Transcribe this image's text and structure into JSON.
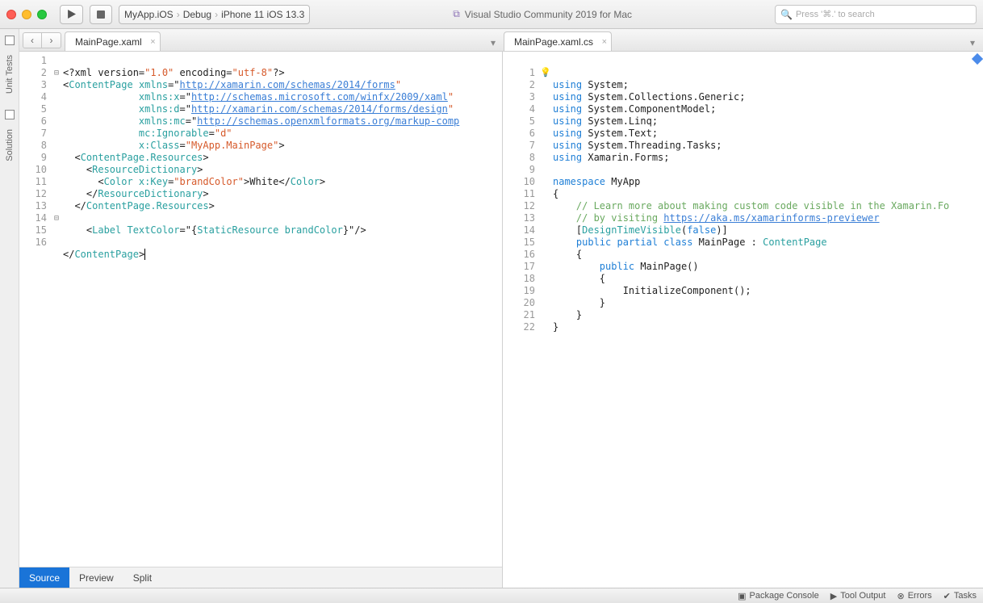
{
  "titlebar": {
    "crumb1": "MyApp.iOS",
    "crumb2": "Debug",
    "crumb3": "iPhone 11 iOS 13.3",
    "app_title": "Visual Studio Community 2019 for Mac",
    "search_placeholder": "Press '⌘.' to search"
  },
  "sidebar": {
    "tab1": "Unit Tests",
    "tab2": "Solution"
  },
  "tabs": {
    "left": "MainPage.xaml",
    "right": "MainPage.xaml.cs"
  },
  "view_tabs": {
    "source": "Source",
    "preview": "Preview",
    "split": "Split"
  },
  "status": {
    "pkg": "Package Console",
    "tool": "Tool Output",
    "errors": "Errors",
    "tasks": "Tasks"
  },
  "left_code": {
    "lines": [
      "1",
      "2",
      "3",
      "4",
      "5",
      "6",
      "7",
      "8",
      "9",
      "10",
      "11",
      "12",
      "13",
      "14",
      "15",
      "16"
    ],
    "l1a": "<?xml version=",
    "l1b": "\"1.0\"",
    "l1c": " encoding=",
    "l1d": "\"utf-8\"",
    "l1e": "?>",
    "l2a": "<",
    "l2b": "ContentPage",
    "l2c": " xmlns",
    "l2d": "=\"",
    "l2e": "http://xamarin.com/schemas/2014/forms",
    "l2f": "\"",
    "l3a": "             xmlns:x",
    "l3b": "=\"",
    "l3c": "http://schemas.microsoft.com/winfx/2009/xaml",
    "l3d": "\"",
    "l4a": "             xmlns:d",
    "l4b": "=\"",
    "l4c": "http://xamarin.com/schemas/2014/forms/design",
    "l4d": "\"",
    "l5a": "             xmlns:mc",
    "l5b": "=\"",
    "l5c": "http://schemas.openxmlformats.org/markup-comp",
    "l6a": "             mc:Ignorable",
    "l6b": "=",
    "l6c": "\"d\"",
    "l7a": "             x:Class",
    "l7b": "=",
    "l7c": "\"MyApp.MainPage\"",
    "l7d": ">",
    "l8a": "  <",
    "l8b": "ContentPage.Resources",
    "l8c": ">",
    "l9a": "    <",
    "l9b": "ResourceDictionary",
    "l9c": ">",
    "l10a": "      <",
    "l10b": "Color",
    "l10c": " x:Key",
    "l10d": "=",
    "l10e": "\"brandColor\"",
    "l10f": ">White</",
    "l10g": "Color",
    "l10h": ">",
    "l11a": "    </",
    "l11b": "ResourceDictionary",
    "l11c": ">",
    "l12a": "  </",
    "l12b": "ContentPage.Resources",
    "l12c": ">",
    "l14a": "    <",
    "l14b": "Label",
    "l14c": " TextColor",
    "l14d": "=\"{",
    "l14e": "StaticResource",
    "l14f": " ",
    "l14g": "brandColor",
    "l14h": "}\"/>",
    "l16a": "</",
    "l16b": "ContentPage",
    "l16c": ">"
  },
  "right_code": {
    "lines": [
      "1",
      "2",
      "3",
      "4",
      "5",
      "6",
      "7",
      "8",
      "9",
      "10",
      "11",
      "12",
      "13",
      "14",
      "15",
      "16",
      "17",
      "18",
      "19",
      "20",
      "21",
      "22"
    ],
    "using": "using",
    "u1": " System;",
    "u2": " System.Collections.Generic;",
    "u3": " System.ComponentModel;",
    "u4": " System.Linq;",
    "u5": " System.Text;",
    "u6": " System.Threading.Tasks;",
    "u7": " Xamarin.Forms;",
    "ns": "namespace",
    "nsn": " MyApp",
    "ob": "{",
    "c1": "    // Learn more about making custom code visible in the Xamarin.Fo",
    "c2": "    // by visiting ",
    "c2l": "https://aka.ms/xamarinforms-previewer",
    "dtv1": "    [",
    "dtv2": "DesignTimeVisible",
    "dtv3": "(",
    "dtv4": "false",
    "dtv5": ")]",
    "pc1": "    ",
    "pc_pub": "public",
    "pc_par": " partial ",
    "pc_cls": "class",
    "pc_name": " MainPage : ",
    "pc_base": "ContentPage",
    "ob2": "    {",
    "ctor1": "        ",
    "ctor_pub": "public",
    "ctor2": " MainPage()",
    "ob3": "        {",
    "init": "            InitializeComponent();",
    "cb3": "        }",
    "cb2": "    }",
    "cb": "}"
  }
}
